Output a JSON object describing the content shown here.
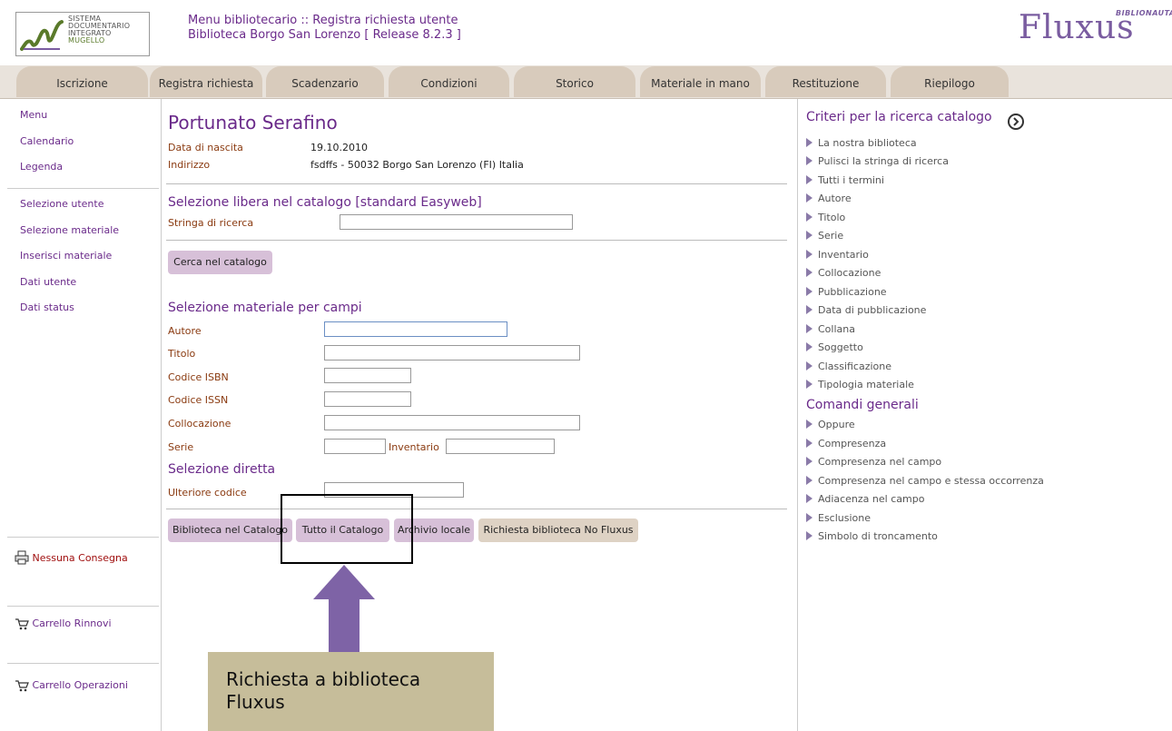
{
  "logo": {
    "line1": "Sistema",
    "line2": "Documentario",
    "line3": "Integrato",
    "line4": "Mugello"
  },
  "header": {
    "title_line1": "Menu bibliotecario :: Registra richiesta utente",
    "title_line2": "Biblioteca Borgo San Lorenzo [ Release 8.2.3 ]",
    "brand": "Fluxus",
    "brand_sub": "BIBLIONAUTA"
  },
  "tabs": [
    "Iscrizione",
    "Registra richiesta",
    "Scadenzario",
    "Condizioni",
    "Storico",
    "Materiale in mano",
    "Restituzione",
    "Riepilogo"
  ],
  "sidebar": {
    "links": [
      "Menu",
      "Calendario",
      "Legenda",
      "Selezione utente",
      "Selezione materiale",
      "Inserisci materiale",
      "Dati utente",
      "Dati status"
    ],
    "nessuna_consegna": "Nessuna Consegna",
    "carrello_rinnovi": "Carrello Rinnovi",
    "carrello_operazioni": "Carrello Operazioni",
    "icons": {
      "print": "printer-icon",
      "cart": "cart-icon"
    }
  },
  "user": {
    "name": "Portunato Serafino",
    "birth_label": "Data di nascita",
    "birth_value": "19.10.2010",
    "address_label": "Indirizzo",
    "address_value": "fsdffs - 50032 Borgo San Lorenzo (FI) Italia"
  },
  "free_search": {
    "title": "Selezione libera nel catalogo [standard Easyweb]",
    "string_label": "Stringa di ricerca",
    "string_value": "",
    "search_button": "Cerca nel catalogo"
  },
  "field_search": {
    "title": "Selezione materiale per campi",
    "autore": "Autore",
    "titolo": "Titolo",
    "isbn": "Codice ISBN",
    "issn": "Codice ISSN",
    "collocazione": "Collocazione",
    "serie": "Serie",
    "inventario": "Inventario"
  },
  "direct": {
    "title": "Selezione diretta",
    "ulteriore": "Ulteriore codice"
  },
  "buttons": {
    "biblioteca": "Biblioteca nel Catalogo",
    "tutto": "Tutto il Catalogo",
    "archivio": "Archivio locale",
    "no_fluxus": "Richiesta biblioteca No Fluxus"
  },
  "criteria": {
    "title": "Criteri per la ricerca catalogo",
    "items": [
      "La nostra biblioteca",
      "Pulisci la stringa di ricerca",
      "Tutti i termini",
      "Autore",
      "Titolo",
      "Serie",
      "Inventario",
      "Collocazione",
      "Pubblicazione",
      "Data di pubblicazione",
      "Collana",
      "Soggetto",
      "Classificazione",
      "Tipologia materiale"
    ],
    "commands_title": "Comandi generali",
    "commands": [
      "Oppure",
      "Compresenza",
      "Compresenza nel campo",
      "Compresenza nel campo e stessa occorrenza",
      "Adiacenza nel campo",
      "Esclusione",
      "Simbolo di troncamento"
    ]
  },
  "callout": {
    "line1": "Richiesta a biblioteca",
    "line2": "Fluxus"
  },
  "colors": {
    "accent": "#6a2a8a",
    "tab": "#d8cbbc",
    "button": "#d7c0d8",
    "callout": "#c6bd9a",
    "arrow": "#7e63a6"
  }
}
